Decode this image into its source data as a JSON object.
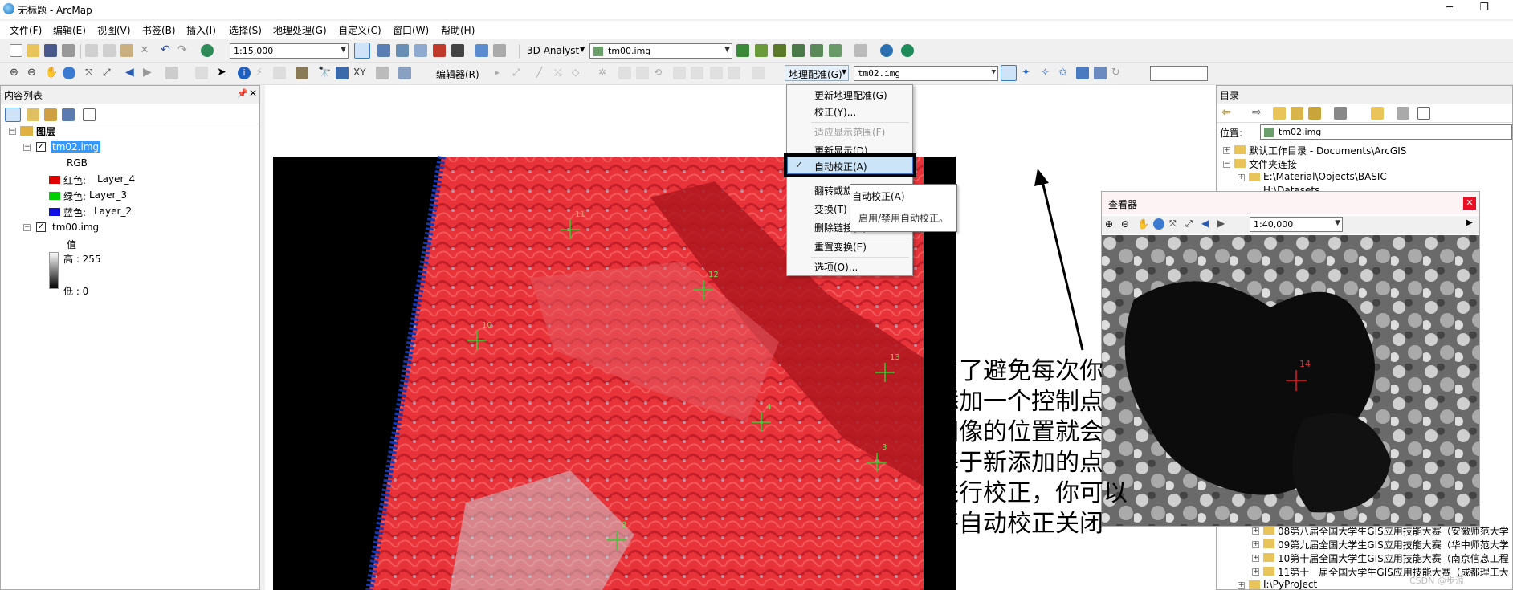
{
  "window": {
    "title": "无标题 - ArcMap"
  },
  "menubar": [
    "文件(F)",
    "编辑(E)",
    "视图(V)",
    "书签(B)",
    "插入(I)",
    "选择(S)",
    "地理处理(G)",
    "自定义(C)",
    "窗口(W)",
    "帮助(H)"
  ],
  "toolbar1": {
    "scale": "1:15,000",
    "analyst": "3D Analyst",
    "layer": "tm00.img"
  },
  "toolbar2": {
    "editor": "编辑器(R)",
    "georef": "地理配准(G)",
    "georef_layer": "tm02.img"
  },
  "toc": {
    "title": "内容列表",
    "root": "图层",
    "layers": [
      {
        "name": "tm02.img",
        "sub": "RGB",
        "bands": [
          {
            "label": "红色:",
            "value": "Layer_4",
            "color": "#e00000"
          },
          {
            "label": "绿色:",
            "value": "Layer_3",
            "color": "#00d000"
          },
          {
            "label": "蓝色:",
            "value": "Layer_2",
            "color": "#1010e0"
          }
        ]
      },
      {
        "name": "tm00.img",
        "sub": "值",
        "high": "高 : 255",
        "low": "低 : 0"
      }
    ]
  },
  "georef_menu": {
    "items": [
      {
        "label": "更新地理配准(G)",
        "enabled": true
      },
      {
        "label": "校正(Y)...",
        "enabled": true
      },
      {
        "label": "适应显示范围(F)",
        "enabled": false
      },
      {
        "label": "更新显示(D)",
        "enabled": true
      },
      {
        "label": "自动校正(A)",
        "enabled": true,
        "highlighted": true
      },
      {
        "label": "翻转或旋转(R)",
        "enabled": true
      },
      {
        "label": "变换(T)",
        "enabled": true
      },
      {
        "label": "删除链接(K)",
        "enabled": true
      },
      {
        "label": "重置变换(E)",
        "enabled": true
      },
      {
        "label": "选项(O)...",
        "enabled": true
      }
    ]
  },
  "tooltip": {
    "title": "自动校正(A)",
    "desc": "启用/禁用自动校正。"
  },
  "map": {
    "points": [
      "11",
      "12",
      "10",
      "13",
      "4",
      "3",
      "2"
    ]
  },
  "catalog": {
    "title": "目录",
    "location_label": "位置:",
    "location_value": "tm02.img",
    "items": [
      "默认工作目录 - Documents\\ArcGIS",
      "文件夹连接",
      "E:\\Material\\Objects\\BASIC",
      "H:\\Datasets",
      "08第八届全国大学生GIS应用技能大赛（安徽师范大学",
      "09第九届全国大学生GIS应用技能大赛（华中师范大学",
      "10第十届全国大学生GIS应用技能大赛（南京信息工程",
      "11第十一届全国大学生GIS应用技能大赛（成都理工大",
      "I:\\PyProJect"
    ]
  },
  "viewer": {
    "title": "查看器",
    "scale": "1:40,000",
    "point": "14"
  },
  "annotation": [
    "为了避免每次你",
    "添加一个控制点",
    "图像的位置就会",
    "基于新添加的点",
    "进行校正，你可以",
    "将自动校正关闭"
  ],
  "watermark": "CSDN @步源"
}
